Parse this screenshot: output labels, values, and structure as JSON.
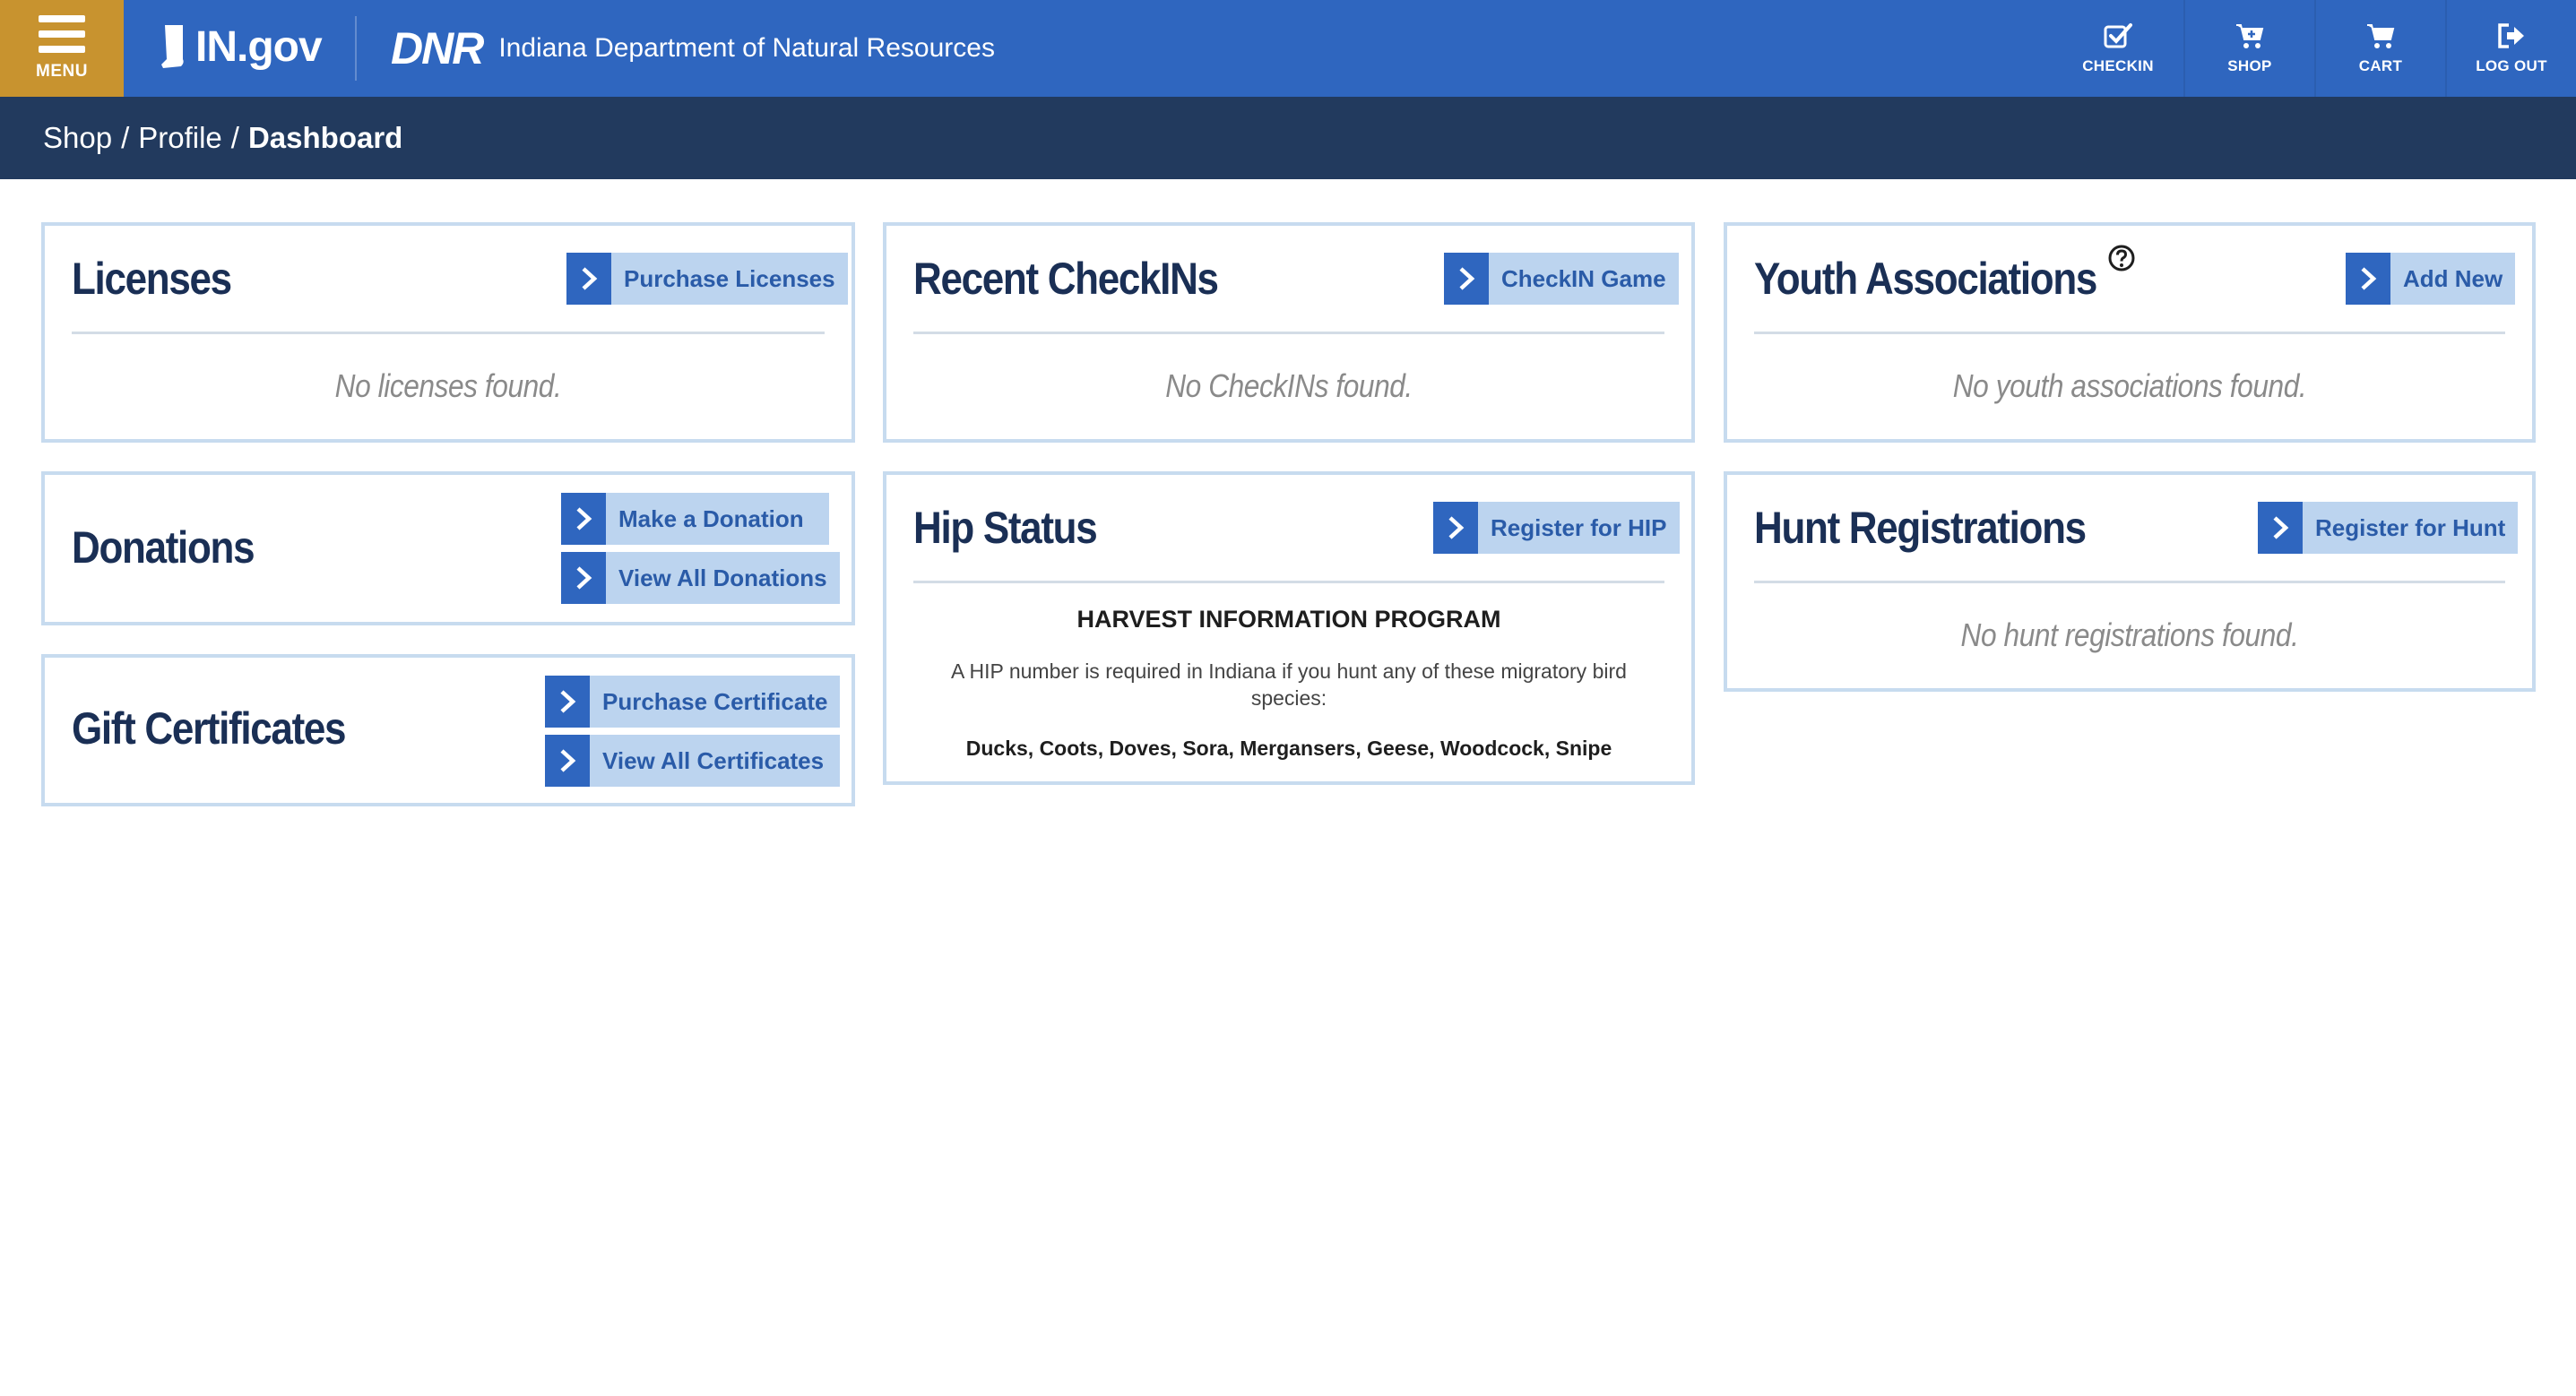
{
  "header": {
    "menu_label": "MENU",
    "ingov_logo": "IN.gov",
    "dnr_logo": "DNR",
    "agency_name": "Indiana Department of Natural Resources",
    "nav": [
      {
        "label": "CHECKIN",
        "icon": "checkbox-icon"
      },
      {
        "label": "SHOP",
        "icon": "cart-plus-icon"
      },
      {
        "label": "CART",
        "icon": "cart-icon"
      },
      {
        "label": "LOG OUT",
        "icon": "logout-icon"
      }
    ],
    "colors": {
      "bar": "#2f66bf",
      "menu": "#c8932f",
      "breadcrumb_bar": "#223a5e"
    }
  },
  "breadcrumb": {
    "items": [
      "Shop",
      "Profile"
    ],
    "separator": "/",
    "current": "Dashboard"
  },
  "cards": {
    "licenses": {
      "title": "Licenses",
      "button": "Purchase Licenses",
      "empty": "No licenses found."
    },
    "checkins": {
      "title": "Recent CheckINs",
      "button": "CheckIN Game",
      "empty": "No CheckINs found."
    },
    "youth": {
      "title": "Youth Associations",
      "button": "Add New",
      "empty": "No youth associations found."
    },
    "donations": {
      "title": "Donations",
      "button1": "Make a Donation",
      "button2": "View All Donations"
    },
    "hip": {
      "title": "Hip Status",
      "button": "Register for HIP",
      "heading": "HARVEST INFORMATION PROGRAM",
      "text": "A HIP number is required in Indiana if you hunt any of these migratory bird species:",
      "species": "Ducks, Coots, Doves, Sora, Mergansers, Geese, Woodcock, Snipe"
    },
    "hunt": {
      "title": "Hunt Registrations",
      "button": "Register for Hunt",
      "empty": "No hunt registrations found."
    },
    "gift": {
      "title": "Gift Certificates",
      "button1": "Purchase Certificate",
      "button2": "View All Certificates"
    }
  },
  "accent_colors": {
    "button_bg": "#bcd4ef",
    "chevron_bg": "#2f66bf",
    "title": "#1a2f55",
    "card_border": "#c7dbef"
  }
}
